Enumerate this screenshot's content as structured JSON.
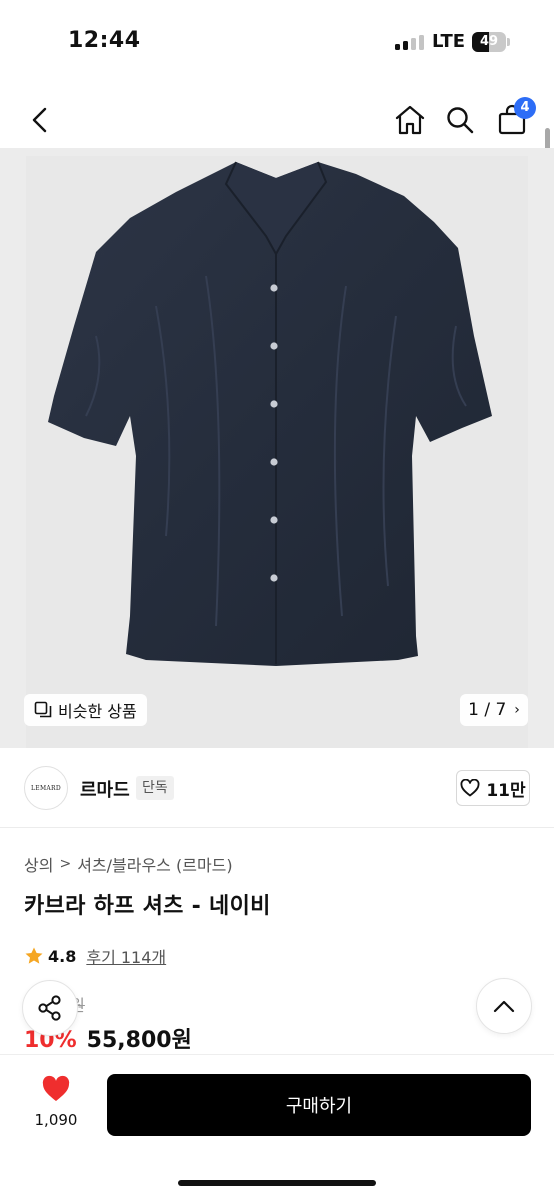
{
  "status_bar": {
    "time": "12:44",
    "network": "LTE",
    "battery": "49",
    "battery_level": 0.49
  },
  "header": {
    "back_icon": "chevron-left-icon",
    "home_icon": "home-icon",
    "search_icon": "search-icon",
    "cart_icon": "shopping-bag-icon",
    "cart_count": "4",
    "accent": "#2d6df6"
  },
  "gallery": {
    "image": "navy-short-sleeve-shirt",
    "similar_label": "비슷한 상품",
    "pager": "1 / 7"
  },
  "brand": {
    "logo_text": "LEMARD",
    "name": "르마드",
    "tag": "단독",
    "likes": "11만"
  },
  "product": {
    "breadcrumb": [
      "상의",
      "셔츠/블라우스 (르마드)"
    ],
    "title": "카브라 하프 셔츠 - 네이비",
    "rating": "4.8",
    "reviews": "후기 114개",
    "original_price_partial": "0원",
    "discount": "10%",
    "price": "55,800원",
    "discount_color": "#ef2e2e"
  },
  "bottom": {
    "wish_count": "1,090",
    "buy_label": "구매하기",
    "heart_color": "#ef2e2e"
  }
}
